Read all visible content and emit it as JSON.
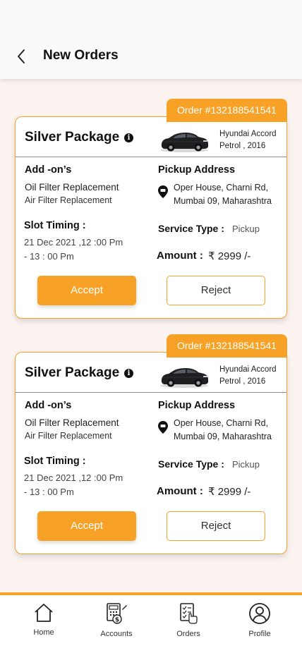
{
  "header": {
    "title": "New Orders"
  },
  "orders": [
    {
      "order_id": "Order #132188541541",
      "package": "Silver Package",
      "car_model": "Hyundai Accord",
      "car_spec": "Petrol , 2016",
      "addons_label": "Add -on’s",
      "addons": [
        "Oil Filter Replacement",
        "Air Filter Replacement"
      ],
      "slot_label": "Slot Timing :",
      "slot_line1": "21 Dec 2021 ,12 :00 Pm",
      "slot_line2": "- 13 : 00 Pm",
      "pickup_label": "Pickup Address",
      "address_line1": "Oper House, Charni Rd,",
      "address_line2": "Mumbai 09, Maharashtra",
      "service_type_label": "Service Type :",
      "service_type": "Pickup",
      "amount_label": "Amount :",
      "amount": "₹ 2999 /-",
      "accept_label": "Accept",
      "reject_label": "Reject"
    },
    {
      "order_id": "Order #132188541541",
      "package": "Silver Package",
      "car_model": "Hyundai Accord",
      "car_spec": "Petrol , 2016",
      "addons_label": "Add -on’s",
      "addons": [
        "Oil Filter Replacement",
        "Air Filter Replacement"
      ],
      "slot_label": "Slot Timing :",
      "slot_line1": "21 Dec 2021 ,12 :00 Pm",
      "slot_line2": "- 13 : 00 Pm",
      "pickup_label": "Pickup Address",
      "address_line1": "Oper House, Charni Rd,",
      "address_line2": "Mumbai 09, Maharashtra",
      "service_type_label": "Service Type :",
      "service_type": "Pickup",
      "amount_label": "Amount :",
      "amount": "₹ 2999 /-",
      "accept_label": "Accept",
      "reject_label": "Reject"
    }
  ],
  "nav": [
    {
      "label": "Home",
      "icon": "home-icon"
    },
    {
      "label": "Accounts",
      "icon": "accounts-icon"
    },
    {
      "label": "Orders",
      "icon": "orders-icon"
    },
    {
      "label": "Profile",
      "icon": "profile-icon"
    }
  ],
  "colors": {
    "accent": "#f7a227",
    "background": "#fbf3ef"
  }
}
